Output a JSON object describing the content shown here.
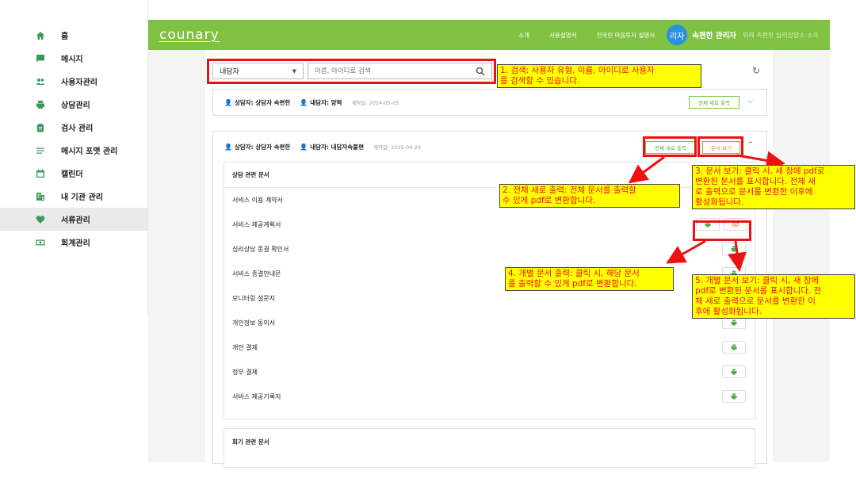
{
  "sidebar": {
    "items": [
      {
        "label": "홈",
        "icon": "home-icon"
      },
      {
        "label": "메시지",
        "icon": "message-icon"
      },
      {
        "label": "사용자관리",
        "icon": "users-icon"
      },
      {
        "label": "상담관리",
        "icon": "print-icon"
      },
      {
        "label": "검사 관리",
        "icon": "clipboard-icon"
      },
      {
        "label": "메시지 포맷 관리",
        "icon": "list-icon"
      },
      {
        "label": "캘린더",
        "icon": "calendar-icon"
      },
      {
        "label": "내 기관 관리",
        "icon": "building-icon"
      },
      {
        "label": "서류관리",
        "icon": "heart-icon"
      },
      {
        "label": "회계관리",
        "icon": "money-icon"
      }
    ]
  },
  "header": {
    "logo": "counary",
    "nav": [
      "소개",
      "사용설명서",
      "전국민 마음투자 설명서"
    ],
    "avatar": "리자",
    "admin_name": "속편한 관리자",
    "admin_org": "위례 속편한 심리상담소 소속"
  },
  "filter": {
    "select_value": "내담자",
    "search_placeholder": "이름, 아이디로 검색"
  },
  "card1": {
    "counselor": "상담자: 상담자 속편한",
    "client": "내담자: 양혁",
    "contract_date": "계약일: 2024-05-05",
    "print_all_label": "전체 새로 출력"
  },
  "card2": {
    "counselor": "상담자: 상담자 속편한",
    "client": "내담자: 내담자속불편",
    "contract_date": "계약일: 2025-04-29",
    "print_all_label": "전체 새로 출력",
    "view_docs_label": "문서 보기",
    "section_title": "상담 관련 문서",
    "documents": [
      "서비스 이용 계약서",
      "서비스 제공계획서",
      "심리상담 종결 확인서",
      "서비스 종결안내문",
      "모니터링 설문지",
      "개인정보 동의서",
      "개인 결제",
      "정부 결제",
      "서비스 제공기록지"
    ],
    "section2_title": "회기 관련 문서"
  },
  "annotations": {
    "a1": "1. 검색: 사용자 유형, 이름, 아이디로 사용자\n를 검색할 수 있습니다.",
    "a2": "2. 전체 새로 출력: 전체 문서를 출력할\n수 있게 pdf로 변환합니다.",
    "a3": "3. 문서 보기: 클릭 시, 새 창에 pdf로\n변환된 문서를 표시합니다. 전체 새\n로 출력으로 문서를 변환한 이후에\n활성화됩니다.",
    "a4": "4. 개별 문서 출력: 클릭 시, 해당 문서\n를 출력할 수 있게 pdf로 변환합니다.",
    "a5": "5. 개별 문서 보기: 클릭 시, 새 창에\npdf로 변환된 문서를 표시합니다. 전\n체 새로 출력으로 문서를 변환한 이\n후에 활성화됩니다."
  },
  "colors": {
    "brand_green": "#7fc241",
    "annotation_red": "#ee1111",
    "annotation_yellow": "#ffff00",
    "avatar_blue": "#2d8fe0"
  }
}
